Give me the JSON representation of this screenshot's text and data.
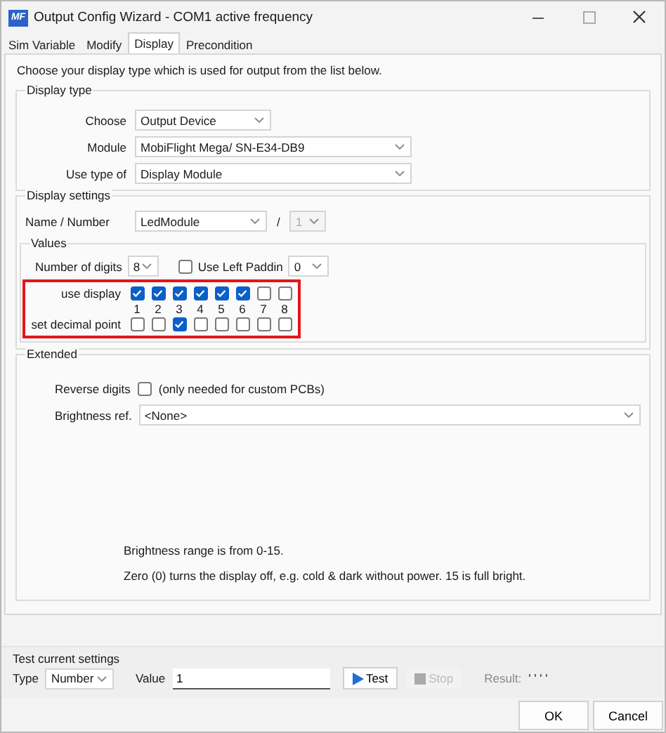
{
  "window": {
    "title": "Output Config Wizard - COM1 active frequency",
    "logo": "MF"
  },
  "tabs": [
    {
      "label": "Sim Variable",
      "selected": false
    },
    {
      "label": "Modify",
      "selected": false
    },
    {
      "label": "Display",
      "selected": true
    },
    {
      "label": "Precondition",
      "selected": false
    }
  ],
  "description": "Choose your display type which is used for output from the list below.",
  "display_type": {
    "title": "Display type",
    "fields": [
      {
        "label": "Choose",
        "value": "Output Device"
      },
      {
        "label": "Module",
        "value": "MobiFlight Mega/ SN-E34-DB9"
      },
      {
        "label": "Use type of",
        "value": "Display Module"
      }
    ]
  },
  "display_settings": {
    "title": "Display settings",
    "name_label": "Name / Number",
    "name_value": "LedModule",
    "separator": "/",
    "number_value": "1",
    "number_disabled": true,
    "values": {
      "title": "Values",
      "digits_label": "Number of digits",
      "digits_value": "8",
      "left_padding": {
        "label": "Use Left Paddin",
        "checked": false,
        "value": "0"
      },
      "highlighted": true,
      "use_display": {
        "label": "use display",
        "checks": [
          true,
          true,
          true,
          true,
          true,
          true,
          false,
          false
        ]
      },
      "digit_labels": [
        "1",
        "2",
        "3",
        "4",
        "5",
        "6",
        "7",
        "8"
      ],
      "decimal_point": {
        "label": "set decimal point",
        "checks": [
          false,
          false,
          true,
          false,
          false,
          false,
          false,
          false
        ]
      }
    }
  },
  "extended": {
    "title": "Extended",
    "reverse_label": "Reverse digits",
    "reverse_checked": false,
    "reverse_note": "(only needed for custom PCBs)",
    "brightness_label": "Brightness ref.",
    "brightness_value": "<None>",
    "notes": [
      "Brightness range is from 0-15.",
      "Zero (0) turns the display off, e.g. cold & dark without power. 15 is full bright."
    ]
  },
  "test": {
    "title": "Test current settings",
    "type_label": "Type",
    "type_value": "Number",
    "value_label": "Value",
    "value": "1",
    "test_button": {
      "label": "Test",
      "disabled": false
    },
    "stop_button": {
      "label": "Stop",
      "disabled": true
    },
    "result_label": "Result:",
    "result_value": "' ' ' '"
  },
  "buttons": [
    "OK",
    "Cancel"
  ]
}
